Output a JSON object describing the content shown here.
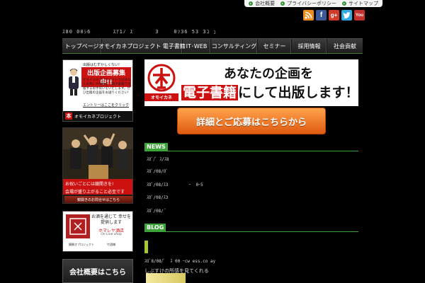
{
  "utility_links": [
    "会社概要",
    "プライバシーポリシー",
    "サイトマップ"
  ],
  "social": {
    "rss": "RSS",
    "facebook": "f",
    "google_plus": "g+",
    "twitter": "t",
    "youtube": "You",
    "colors": {
      "rss": "#f08a1c",
      "facebook": "#3b5998",
      "google_plus": "#d23a2a",
      "twitter": "#33a9e0",
      "youtube": "#c4302b"
    }
  },
  "header": {
    "tagline": "ｽ80 00ｼ6      ｽｱ1ﾉ ｽ      3    0ｿ36 53 3ｺ ｭ"
  },
  "nav": {
    "items": [
      "トップページ",
      "オモイカネプロジェクト 電子書籍",
      "IT･WEB",
      "コンサルティング",
      "セミナー",
      "採用情報",
      "社会貢献"
    ]
  },
  "sidebar": {
    "banner1": {
      "subhead": "出版はむずかしくない!",
      "title": "出版企画募集中!!",
      "body": "オモイカネプロジェクトではあなたの想いや経験を、電子書籍で出版するお手伝いをいたします。ぜひ出版の企画をお送りください!",
      "entry": "エントリーはここをクリック",
      "footer_logo": "本",
      "footer": "オモイカネプロジェクト"
    },
    "banner2": {
      "line1": "お祝いごとには鏡開きを!",
      "line2": "会場が盛り上がること必至です",
      "button": "鏡開きのお問合せはこちら"
    },
    "banner3": {
      "title": "お酒を通じて 幸せを提供します",
      "shop": "ホマレヤ酒店",
      "shop_en": "On Line shop",
      "product1": "鏡開きプロジェクト",
      "product2": "竹酒樽"
    },
    "banner4": {
      "label": "会社概要はこちら"
    }
  },
  "promo": {
    "logo_text": "オモイカネ",
    "line1": "あなたの企画を",
    "line2_highlight": "電子書籍",
    "line2_rest": "にして出版します！",
    "button": "詳細とご応募はこちらから"
  },
  "news": {
    "label": "NEWS",
    "items": [
      "ｽ0ﾞ/ﾞ ｽ/ｽ8",
      "ｽ0ﾞ/08/0ﾞ",
      "ｽ0ﾞ/08/ｽ3        ｰ  0ｰ5",
      "ｽ0ﾞ/08/ｽ3",
      "ｽ0ﾞ/08/ ﾞ"
    ]
  },
  "blog": {
    "label": "BLOG",
    "meta": "ｽ0ﾞ8/08/ﾞ  ｽ 00 ｰcw ess.co ay",
    "title": "しぶすけの所感を見てくれる"
  }
}
